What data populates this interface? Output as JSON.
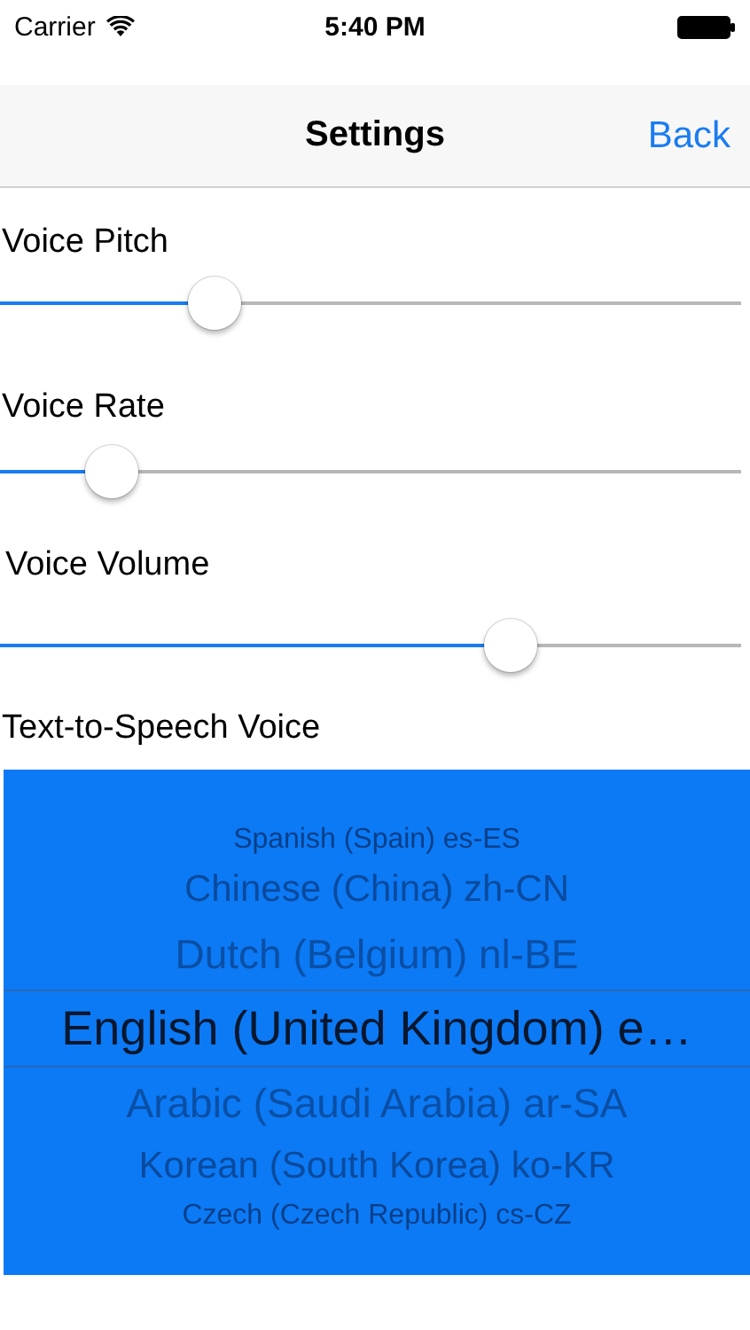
{
  "status_bar": {
    "carrier": "Carrier",
    "time": "5:40 PM"
  },
  "nav_bar": {
    "title": "Settings",
    "back": "Back"
  },
  "sliders": [
    {
      "label": "Voice Pitch",
      "level": 0.29
    },
    {
      "label": "Voice Rate",
      "level": 0.15
    },
    {
      "label": "Voice Volume",
      "level": 0.69
    }
  ],
  "voice_picker": {
    "label": "Text-to-Speech Voice",
    "options": [
      {
        "label": "Spanish (Spain) es-ES",
        "selected": false
      },
      {
        "label": "Chinese (China) zh-CN",
        "selected": false
      },
      {
        "label": "Dutch (Belgium) nl-BE",
        "selected": false
      },
      {
        "label": "English (United Kingdom) e…",
        "selected": true
      },
      {
        "label": "Arabic (Saudi Arabia) ar-SA",
        "selected": false
      },
      {
        "label": "Korean (South Korea) ko-KR",
        "selected": false
      },
      {
        "label": "Czech (Czech Republic) cs-CZ",
        "selected": false
      }
    ]
  }
}
